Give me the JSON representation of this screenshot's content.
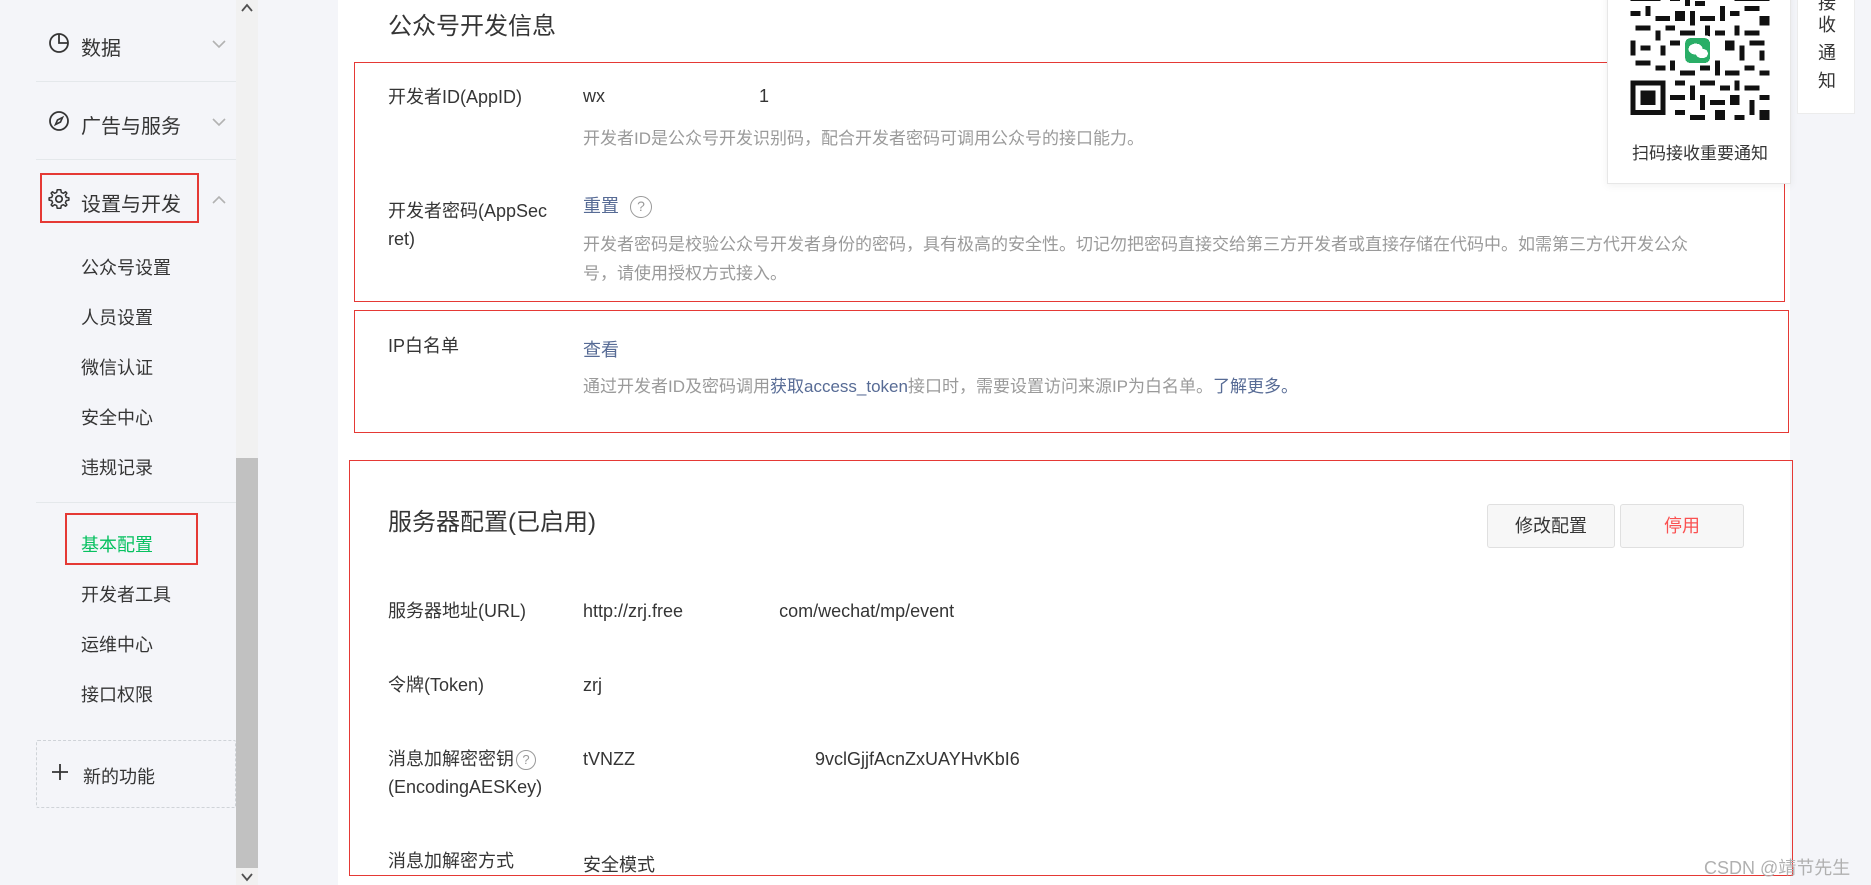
{
  "sidebar": {
    "groups": [
      {
        "label": "数据",
        "icon": "chart-pie-icon",
        "expanded": false
      },
      {
        "label": "广告与服务",
        "icon": "compass-icon",
        "expanded": false
      },
      {
        "label": "设置与开发",
        "icon": "gear-icon",
        "expanded": true
      }
    ],
    "sub_items_a": [
      "公众号设置",
      "人员设置",
      "微信认证",
      "安全中心",
      "违规记录"
    ],
    "sub_items_b": [
      "基本配置",
      "开发者工具",
      "运维中心",
      "接口权限"
    ],
    "active_item": "基本配置",
    "new_feature_label": "新的功能"
  },
  "dev_info": {
    "title": "公众号开发信息",
    "appid_label": "开发者ID(AppID)",
    "appid_value_prefix": "wx",
    "appid_value_suffix": "1",
    "appid_desc": "开发者ID是公众号开发识别码，配合开发者密码可调用公众号的接口能力。",
    "secret_label_line1": "开发者密码(AppSec",
    "secret_label_line2": "ret)",
    "secret_reset": "重置",
    "secret_desc_line1": "开发者密码是校验公众号开发者身份的密码，具有极高的安全性。切记勿把密码直接交给第三方开发者或直接存储在代码中。如需第三方代开发公众",
    "secret_desc_line2": "号，请使用授权方式接入。",
    "ip_label": "IP白名单",
    "ip_view": "查看",
    "ip_desc_pre": "通过开发者ID及密码调用",
    "ip_desc_link": "获取access_token",
    "ip_desc_mid": "接口时，需要设置访问来源IP为白名单。",
    "ip_desc_more": "了解更多。"
  },
  "server": {
    "title": "服务器配置(已启用)",
    "edit_button": "修改配置",
    "stop_button": "停用",
    "url_label": "服务器地址(URL)",
    "url_value_a": "http://zrj.free",
    "url_value_b": "com/wechat/mp/event",
    "token_label": "令牌(Token)",
    "token_value": "zrj",
    "aes_label_line1": "消息加解密密钥",
    "aes_label_line2": "(EncodingAESKey)",
    "aes_value_a": "tVNZZ",
    "aes_value_b": "9vclGjjfAcnZxUAYHvKbI6",
    "mode_label": "消息加解密方式",
    "mode_value": "安全模式"
  },
  "qr": {
    "caption": "扫码接收重要通知",
    "tab_chars": [
      "接",
      "收",
      "通",
      "知"
    ]
  },
  "colors": {
    "accent_green": "#07c160",
    "link_blue": "#576b95",
    "danger_red": "#fa5151",
    "highlight_red": "#e53935"
  },
  "watermark": "CSDN @靖节先生"
}
